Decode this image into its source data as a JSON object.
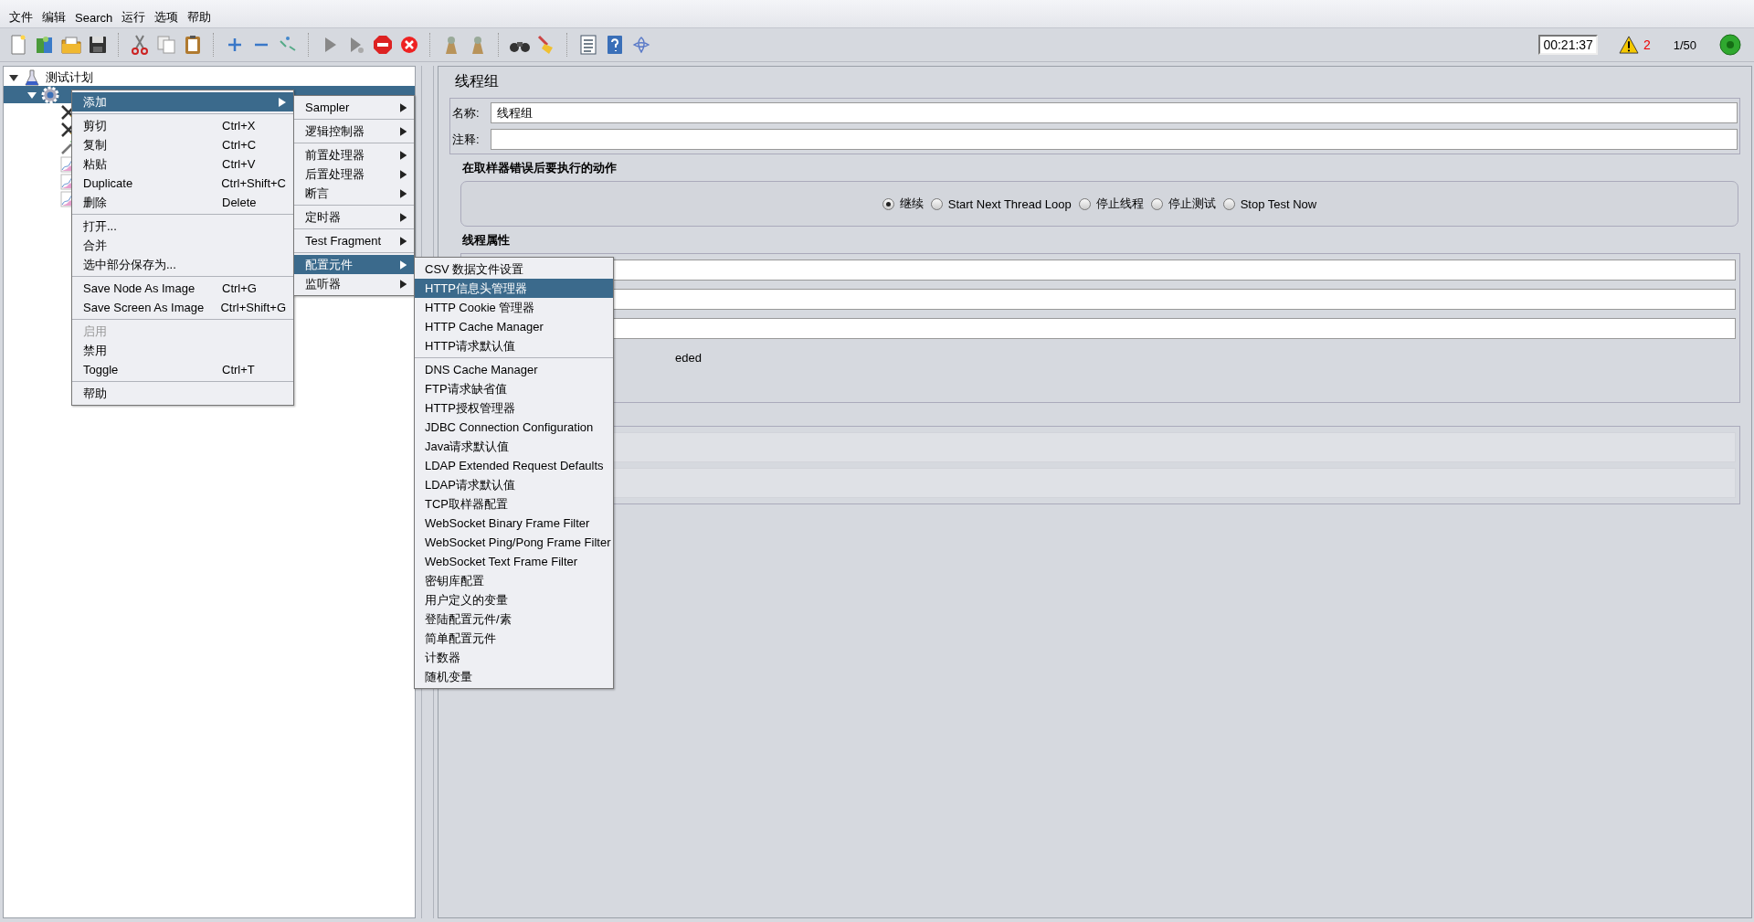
{
  "menu_bar": [
    {
      "label": "文件"
    },
    {
      "label": "编辑"
    },
    {
      "label": "Search"
    },
    {
      "label": "运行"
    },
    {
      "label": "选项"
    },
    {
      "label": "帮助"
    }
  ],
  "status": {
    "elapsed": "00:21:37",
    "warnings": "2",
    "threads": "1/50",
    "running": true
  },
  "tree": [
    {
      "label": "测试计划",
      "expanded": true,
      "selected": false,
      "kind": "plan",
      "children": [
        {
          "expanded": true,
          "selected": true,
          "kind": "gear",
          "children": [
            {
              "kind": "tools",
              "selected": false
            },
            {
              "kind": "tools",
              "selected": false
            },
            {
              "kind": "dropper",
              "selected": false
            },
            {
              "kind": "chart",
              "selected": false
            },
            {
              "kind": "chart",
              "selected": false
            },
            {
              "kind": "chart",
              "selected": false
            }
          ]
        }
      ]
    }
  ],
  "panel": {
    "title": "线程组",
    "name_label": "名称:",
    "name_value": "线程组",
    "comment_label": "注释:",
    "error_section": "在取样器错误后要执行的动作",
    "error_actions": [
      {
        "label": "继续",
        "selected": true
      },
      {
        "label": "Start Next Thread Loop",
        "selected": false
      },
      {
        "label": "停止线程",
        "selected": false
      },
      {
        "label": "停止测试",
        "selected": false
      },
      {
        "label": "Stop Test Now",
        "selected": false
      }
    ],
    "thread_section": "线程属性",
    "partial_text": "eded"
  },
  "context_menu": [
    [
      {
        "label": "添加",
        "submenu": true,
        "selected": true,
        "disabled": false
      }
    ],
    [
      {
        "label": "剪切",
        "shortcut": "Ctrl+X",
        "selected": false,
        "disabled": false
      },
      {
        "label": "复制",
        "shortcut": "Ctrl+C",
        "selected": false,
        "disabled": false
      },
      {
        "label": "粘贴",
        "shortcut": "Ctrl+V",
        "selected": false,
        "disabled": false
      },
      {
        "label": "Duplicate",
        "shortcut": "Ctrl+Shift+C",
        "selected": false,
        "disabled": false
      },
      {
        "label": "删除",
        "shortcut": "Delete",
        "selected": false,
        "disabled": false
      }
    ],
    [
      {
        "label": "打开...",
        "selected": false,
        "disabled": false
      },
      {
        "label": "合并",
        "selected": false,
        "disabled": false
      },
      {
        "label": "选中部分保存为...",
        "selected": false,
        "disabled": false
      }
    ],
    [
      {
        "label": "Save Node As Image",
        "shortcut": "Ctrl+G",
        "selected": false,
        "disabled": false
      },
      {
        "label": "Save Screen As Image",
        "shortcut": "Ctrl+Shift+G",
        "selected": false,
        "disabled": false
      }
    ],
    [
      {
        "label": "启用",
        "selected": false,
        "disabled": true
      },
      {
        "label": "禁用",
        "selected": false,
        "disabled": false
      },
      {
        "label": "Toggle",
        "shortcut": "Ctrl+T",
        "selected": false,
        "disabled": false
      }
    ],
    [
      {
        "label": "帮助",
        "selected": false,
        "disabled": false
      }
    ]
  ],
  "add_menu": [
    [
      {
        "label": "Sampler",
        "submenu": true,
        "selected": false
      }
    ],
    [
      {
        "label": "逻辑控制器",
        "submenu": true,
        "selected": false
      }
    ],
    [
      {
        "label": "前置处理器",
        "submenu": true,
        "selected": false
      },
      {
        "label": "后置处理器",
        "submenu": true,
        "selected": false
      },
      {
        "label": "断言",
        "submenu": true,
        "selected": false
      }
    ],
    [
      {
        "label": "定时器",
        "submenu": true,
        "selected": false
      }
    ],
    [
      {
        "label": "Test Fragment",
        "submenu": true,
        "selected": false
      }
    ],
    [
      {
        "label": "配置元件",
        "submenu": true,
        "selected": true
      },
      {
        "label": "监听器",
        "submenu": true,
        "selected": false
      }
    ]
  ],
  "config_menu": [
    [
      {
        "label": "CSV 数据文件设置",
        "selected": false
      },
      {
        "label": "HTTP信息头管理器",
        "selected": true
      },
      {
        "label": "HTTP Cookie 管理器",
        "selected": false
      },
      {
        "label": "HTTP Cache Manager",
        "selected": false
      },
      {
        "label": "HTTP请求默认值",
        "selected": false
      }
    ],
    [
      {
        "label": "DNS Cache Manager",
        "selected": false
      },
      {
        "label": "FTP请求缺省值",
        "selected": false
      },
      {
        "label": "HTTP授权管理器",
        "selected": false
      },
      {
        "label": "JDBC Connection Configuration",
        "selected": false
      },
      {
        "label": "Java请求默认值",
        "selected": false
      },
      {
        "label": "LDAP Extended Request Defaults",
        "selected": false
      },
      {
        "label": "LDAP请求默认值",
        "selected": false
      },
      {
        "label": "TCP取样器配置",
        "selected": false
      },
      {
        "label": "WebSocket Binary Frame Filter",
        "selected": false
      },
      {
        "label": "WebSocket Ping/Pong Frame Filter",
        "selected": false
      },
      {
        "label": "WebSocket Text Frame Filter",
        "selected": false
      },
      {
        "label": "密钥库配置",
        "selected": false
      },
      {
        "label": "用户定义的变量",
        "selected": false
      },
      {
        "label": "登陆配置元件/素",
        "selected": false
      },
      {
        "label": "简单配置元件",
        "selected": false
      },
      {
        "label": "计数器",
        "selected": false
      },
      {
        "label": "随机变量",
        "selected": false
      }
    ]
  ]
}
